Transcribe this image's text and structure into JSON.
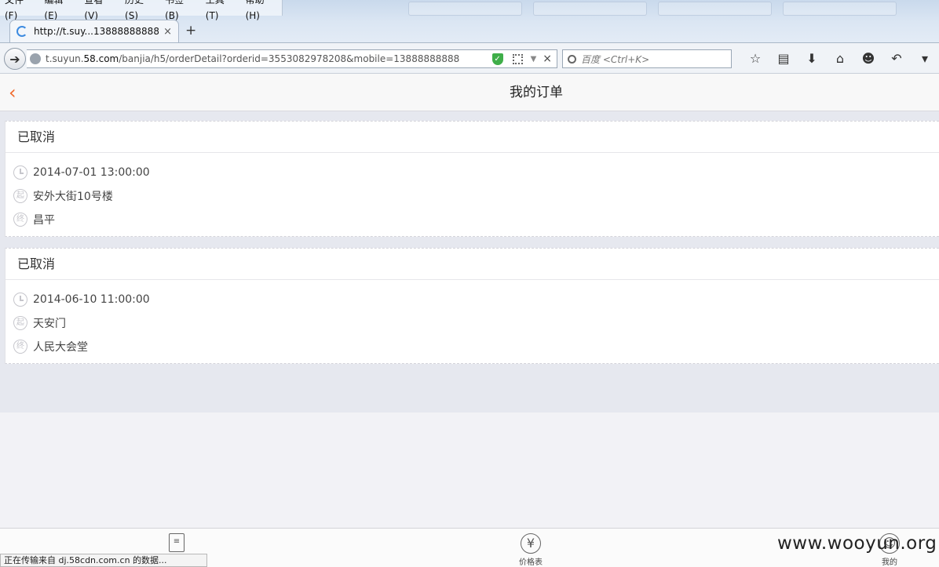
{
  "browser": {
    "menu": [
      "文件(F)",
      "编辑(E)",
      "查看(V)",
      "历史(S)",
      "书签(B)",
      "工具(T)",
      "帮助(H)"
    ],
    "tab_title": "http://t.suy...13888888888",
    "new_tab_symbol": "+",
    "close_symbol": "×",
    "url_host": "t.suyun.",
    "url_domain": "58.com",
    "url_path": "/banjia/h5/orderDetail?orderid=3553082978208&mobile=13888888888",
    "search_placeholder": "百度 <Ctrl+K>",
    "status_text": "正在传输来自 dj.58cdn.com.cn 的数据..."
  },
  "page": {
    "title": "我的订单",
    "orders": [
      {
        "status": "已取消",
        "time": "2014-07-01 13:00:00",
        "start_badge": "起",
        "start": "安外大街10号楼",
        "end_badge": "终",
        "end": "昌平"
      },
      {
        "status": "已取消",
        "time": "2014-06-10 11:00:00",
        "start_badge": "起",
        "start": "天安门",
        "end_badge": "终",
        "end": "人民大会堂"
      }
    ]
  },
  "tabbar": {
    "price_symbol": "¥",
    "price_label": "价格表",
    "mine_label": "我的"
  },
  "watermark": "www.wooyun.org"
}
